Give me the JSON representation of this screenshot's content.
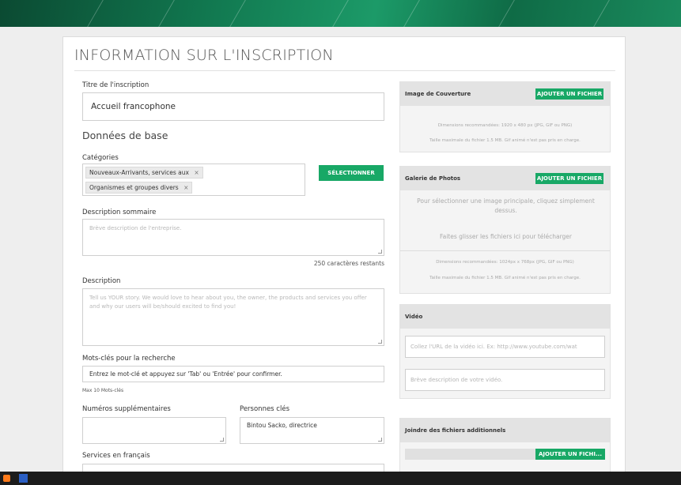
{
  "page": {
    "title": "INFORMATION SUR L'INSCRIPTION"
  },
  "form": {
    "listing_title_label": "Titre de l'inscription",
    "listing_title_value": "Accueil francophone",
    "basic_data_heading": "Données de base",
    "categories_label": "Catégories",
    "categories": [
      "Nouveaux-Arrivants, services aux",
      "Organismes et groupes divers"
    ],
    "select_button": "SÉLECTIONNER",
    "summary_label": "Description sommaire",
    "summary_placeholder": "Brève description de l'entreprise.",
    "chars_remaining": "250 caractères restants",
    "description_label": "Description",
    "description_placeholder": "Tell us YOUR story. We would love to hear about you, the owner, the products and services you offer and why our users will be/should excited to find you!",
    "keywords_label": "Mots-clés pour la recherche",
    "keywords_placeholder": "Entrez le mot-clé et appuyez sur 'Tab' ou 'Entrée' pour confirmer.",
    "keywords_max": "Max 10 Mots-clés",
    "extra_numbers_label": "Numéros supplémentaires",
    "key_people_label": "Personnes clés",
    "key_people_value": "Bintou Sacko, directrice",
    "services_fr_label": "Services en français"
  },
  "cover": {
    "title": "Image de Couverture",
    "add_button": "AJOUTER UN FICHIER",
    "dims": "Dimensions recommandées: 1920 x 480 px (JPG, GIF ou PNG)",
    "max": "Taille maximale du fichier 1.5 MB. Gif animé n'est pas pris en charge."
  },
  "gallery": {
    "title": "Galerie de Photos",
    "add_button": "AJOUTER UN FICHIER",
    "select_main": "Pour sélectionner une image principale, cliquez simplement dessus.",
    "drag_text": "Faites glisser les fichiers ici pour télécharger",
    "dims": "Dimensions recommandées: 1024px x 768px (JPG, GIF ou PNG)",
    "max": "Taille maximale du fichier 1.5 MB. Gif animé n'est pas pris en charge."
  },
  "video": {
    "title": "Vidéo",
    "url_placeholder": "Collez l'URL de la vidéo ici. Ex: http://www.youtube.com/wat",
    "desc_placeholder": "Brève description de votre vidéo."
  },
  "attachments": {
    "title": "Joindre des fichiers additionnels",
    "add_button": "AJOUTER UN FICHI..."
  },
  "colors": {
    "accent": "#18a866",
    "banner": "#11774f"
  }
}
